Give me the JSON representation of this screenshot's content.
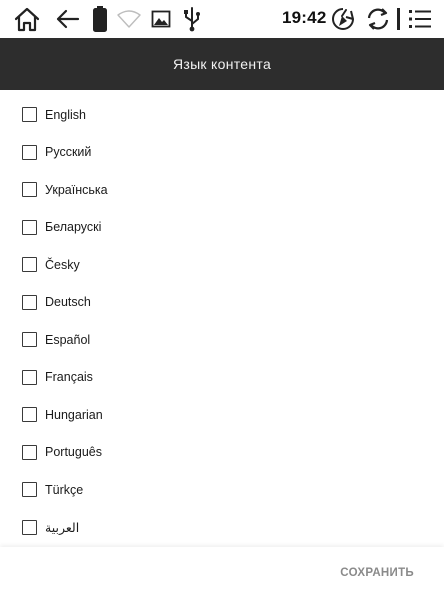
{
  "status_bar": {
    "time": "19:42",
    "icons": [
      "home-icon",
      "back-icon",
      "battery-icon",
      "wifi-icon",
      "gallery-icon",
      "usb-icon",
      "sync-clean-icon",
      "refresh-icon",
      "menu-icon"
    ]
  },
  "header": {
    "title": "Язык контента"
  },
  "languages": [
    {
      "label": "English",
      "checked": false
    },
    {
      "label": "Русский",
      "checked": false
    },
    {
      "label": "Українська",
      "checked": false
    },
    {
      "label": "Беларускі",
      "checked": false
    },
    {
      "label": "Česky",
      "checked": false
    },
    {
      "label": "Deutsch",
      "checked": false
    },
    {
      "label": "Español",
      "checked": false
    },
    {
      "label": "Français",
      "checked": false
    },
    {
      "label": "Hungarian",
      "checked": false
    },
    {
      "label": "Português",
      "checked": false
    },
    {
      "label": "Türkçe",
      "checked": false
    },
    {
      "label": "العربية",
      "checked": false
    }
  ],
  "footer": {
    "save_label": "СОХРАНИТЬ"
  },
  "colors": {
    "header_bg": "#2d2d2d",
    "header_text": "#f2f2f2",
    "save_text": "#8a8a8a"
  }
}
